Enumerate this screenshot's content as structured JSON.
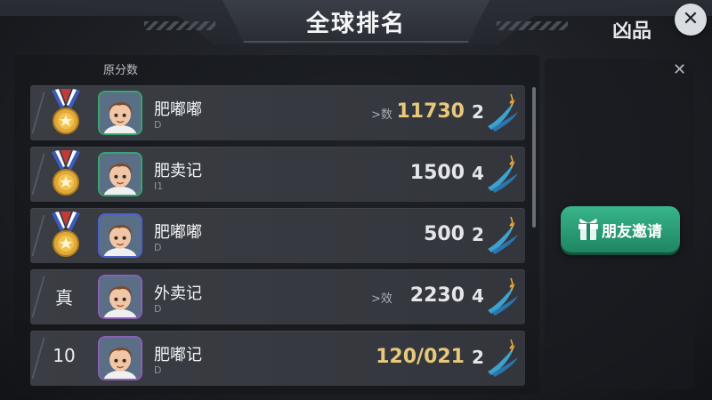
{
  "header": {
    "title": "全球排名"
  },
  "columns": {
    "name_header": "原分数",
    "score_header": "凶品"
  },
  "rows": [
    {
      "rank_type": "medal",
      "rank": "",
      "name": "肥嘟嘟",
      "sub": "D",
      "tag": ">数",
      "score": "11730",
      "score_color": "gold",
      "icon_text": "2"
    },
    {
      "rank_type": "medal",
      "rank": "",
      "name": "肥卖记",
      "sub": "I1",
      "tag": "",
      "score": "1500",
      "score_color": "white",
      "icon_text": "4"
    },
    {
      "rank_type": "medal",
      "rank": "",
      "name": "肥嘟嘟",
      "sub": "D",
      "tag": "",
      "score": "500",
      "score_color": "white",
      "icon_text": "2"
    },
    {
      "rank_type": "text",
      "rank": "真",
      "name": "外卖记",
      "sub": "D",
      "tag": ">效",
      "score": "2230",
      "score_color": "white",
      "icon_text": "4"
    },
    {
      "rank_type": "text",
      "rank": "10",
      "name": "肥嘟记",
      "sub": "D",
      "tag": "",
      "score": "120/021",
      "score_color": "gold",
      "icon_text": "2"
    }
  ],
  "side": {
    "invite_label": "朋友邀请"
  },
  "icons": {
    "close": "close-icon",
    "medal": "medal-icon",
    "avatar": "avatar-icon",
    "score_badge": "wing-score-icon",
    "invite": "gift-icon"
  },
  "colors": {
    "accent_green": "#2a9a72",
    "gold": "#e8c87a",
    "medal_gold": "#e0a93a",
    "ribbon_red": "#c23b3b",
    "ribbon_blue": "#3c5bbf"
  }
}
